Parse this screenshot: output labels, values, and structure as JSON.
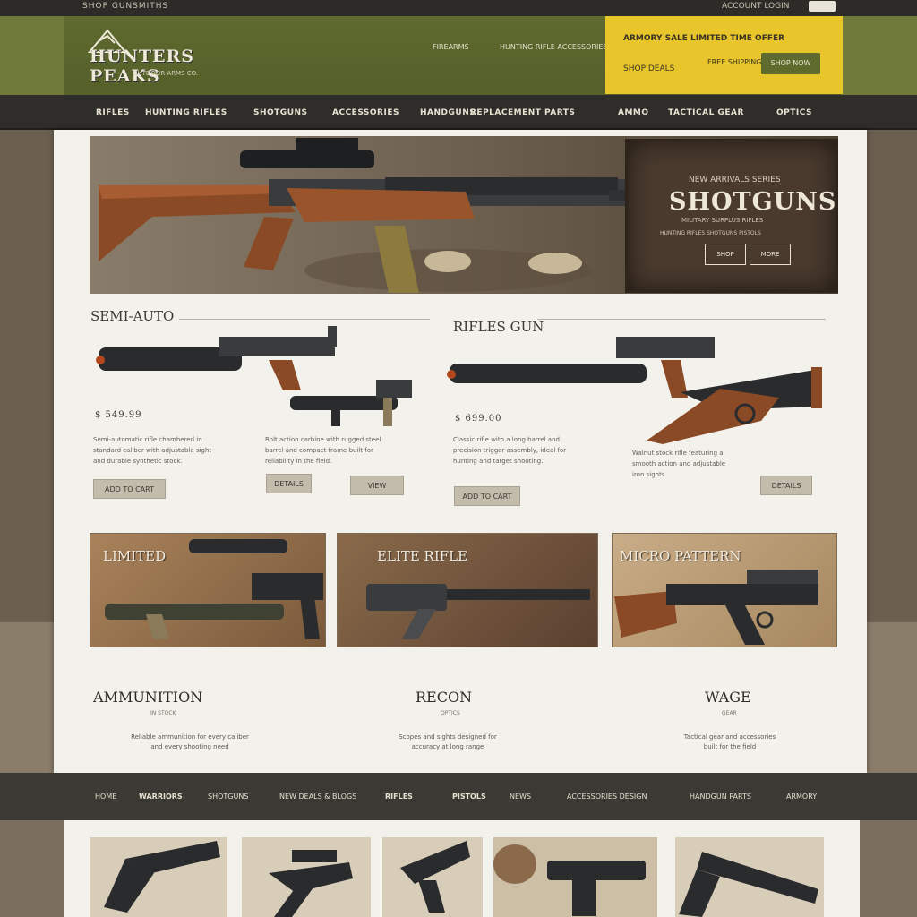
{
  "topbar": {
    "left_text": "SHOP GUNSMITHS",
    "right_text": "ACCOUNT LOGIN",
    "cart_icon": "cart-icon"
  },
  "header": {
    "logo_name": "HUNTERS PEAKS",
    "logo_tagline": "OUTDOOR ARMS CO.",
    "links": [
      "FIREARMS",
      "HUNTING RIFLE ACCESSORIES"
    ],
    "promo": {
      "headline": "ARMORY SALE  LIMITED TIME OFFER",
      "subtext": "SHOP DEALS",
      "offer": "FREE SHIPPING",
      "button": "SHOP NOW"
    }
  },
  "nav": [
    "RIFLES",
    "HUNTING RIFLES",
    "SHOTGUNS",
    "ACCESSORIES",
    "HANDGUNS",
    "REPLACEMENT PARTS",
    "AMMO",
    "TACTICAL GEAR",
    "OPTICS"
  ],
  "hero": {
    "kicker": "NEW ARRIVALS SERIES",
    "title": "SHOTGUNS",
    "sub1": "MILITARY SURPLUS RIFLES",
    "sub2": "HUNTING RIFLES SHOTGUNS PISTOLS",
    "buttons": [
      "SHOP",
      "MORE"
    ]
  },
  "products": {
    "left": {
      "title": "SEMI-AUTO",
      "label": "$ 549.99",
      "desc_a": [
        "Semi-automatic rifle chambered in",
        "standard caliber with adjustable sight",
        "and durable synthetic stock."
      ],
      "desc_b": [
        "Bolt action carbine with rugged steel",
        "barrel and compact frame built for",
        "reliability in the field."
      ],
      "button_a": "ADD TO CART",
      "button_b": "DETAILS",
      "button_c": "VIEW"
    },
    "right": {
      "title": "RIFLES GUN",
      "label": "$ 699.00",
      "desc_a": [
        "Classic rifle with a long barrel and",
        "precision trigger assembly, ideal for",
        "hunting and target shooting."
      ],
      "desc_b": [
        "Walnut stock rifle featuring a",
        "smooth action and adjustable",
        "iron sights."
      ],
      "button_a": "ADD TO CART",
      "button_b": "DETAILS"
    }
  },
  "tiles": [
    "LIMITED",
    "ELITE RIFLE",
    "MICRO PATTERN"
  ],
  "features": [
    {
      "title": "AMMUNITION",
      "sub": "IN STOCK",
      "desc": [
        "Reliable ammunition for every caliber",
        "and every shooting need"
      ]
    },
    {
      "title": "RECON",
      "sub": "OPTICS",
      "desc": [
        "Scopes and sights designed for",
        "accuracy at long range"
      ]
    },
    {
      "title": "WAGE",
      "sub": "GEAR",
      "desc": [
        "Tactical gear and accessories",
        "built for the field"
      ]
    }
  ],
  "bottom_nav": [
    "HOME",
    "WARRIORS",
    "SHOTGUNS",
    "NEW DEALS & BLOGS",
    "RIFLES",
    "PISTOLS",
    "NEWS",
    "ACCESSORIES DESIGN",
    "HANDGUN PARTS",
    "ARMORY"
  ],
  "colors": {
    "olive": "#6f7a3a",
    "promo_yellow": "#e8c52b",
    "nav_dark": "#2f2d29",
    "paper": "#f3f1ec"
  }
}
